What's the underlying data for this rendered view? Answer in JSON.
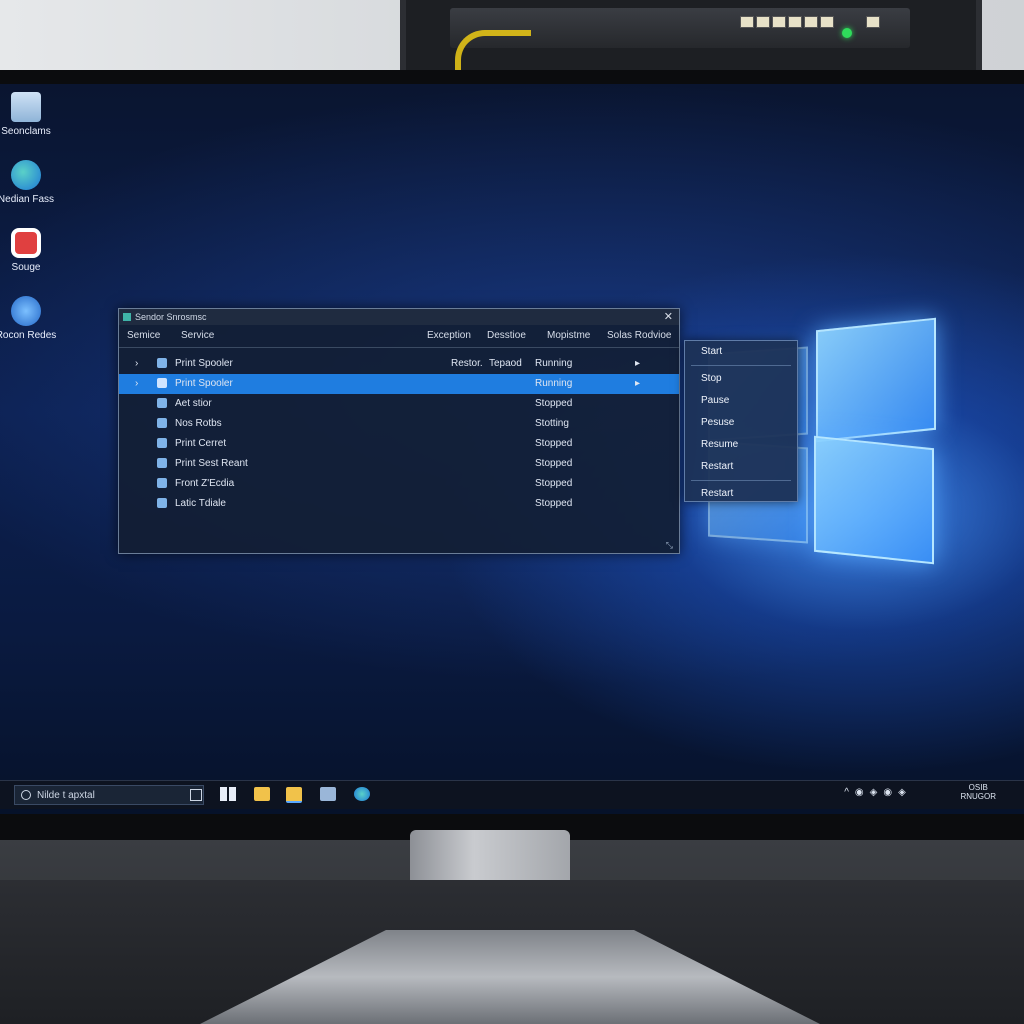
{
  "desktop": {
    "icons": [
      {
        "label": "Seonclams",
        "icon": "recycle-bin-icon"
      },
      {
        "label": "Nedian Fass",
        "icon": "edge-icon"
      },
      {
        "label": "Souge",
        "icon": "record-icon"
      },
      {
        "label": "Rocon Redes",
        "icon": "network-icon"
      }
    ]
  },
  "services_window": {
    "title": "Sendor Snrosmsc",
    "columns": [
      "Semice",
      "Service",
      "Exception",
      "Desstioe",
      "Mopistme",
      "Solas Rodvioe"
    ],
    "rows": [
      {
        "toggle": "›",
        "name": "Print Spooler",
        "c1": "Restor.",
        "c2": "Tepaod",
        "status": "Running",
        "arrow": "▸"
      },
      {
        "toggle": "›",
        "name": "Print Spooler",
        "c1": "",
        "c2": "",
        "status": "Running",
        "arrow": "▸",
        "selected": true
      },
      {
        "toggle": "",
        "name": "Aet stior",
        "c1": "",
        "c2": "",
        "status": "Stopped",
        "arrow": ""
      },
      {
        "toggle": "",
        "name": "Nos Rotbs",
        "c1": "",
        "c2": "",
        "status": "Stotting",
        "arrow": ""
      },
      {
        "toggle": "",
        "name": "Print Cerret",
        "c1": "",
        "c2": "",
        "status": "Stopped",
        "arrow": ""
      },
      {
        "toggle": "",
        "name": "Print Sest Reant",
        "c1": "",
        "c2": "",
        "status": "Stopped",
        "arrow": ""
      },
      {
        "toggle": "",
        "name": "Front Z'Ecdia",
        "c1": "",
        "c2": "",
        "status": "Stopped",
        "arrow": ""
      },
      {
        "toggle": "",
        "name": "Latic Tdiale",
        "c1": "",
        "c2": "",
        "status": "Stopped",
        "arrow": ""
      }
    ]
  },
  "context_menu": {
    "items": [
      "Start",
      "Stop",
      "Pause",
      "Pesuse",
      "Resume",
      "Restart",
      "Restart"
    ]
  },
  "taskbar": {
    "search_text": "Nilde t apxtal",
    "tray_line1": "OSIB",
    "tray_line2": "RNUGOR"
  },
  "colors": {
    "selection": "#1f7de0",
    "window_bg": "#121e34",
    "accent_glow": "#4696ff"
  }
}
